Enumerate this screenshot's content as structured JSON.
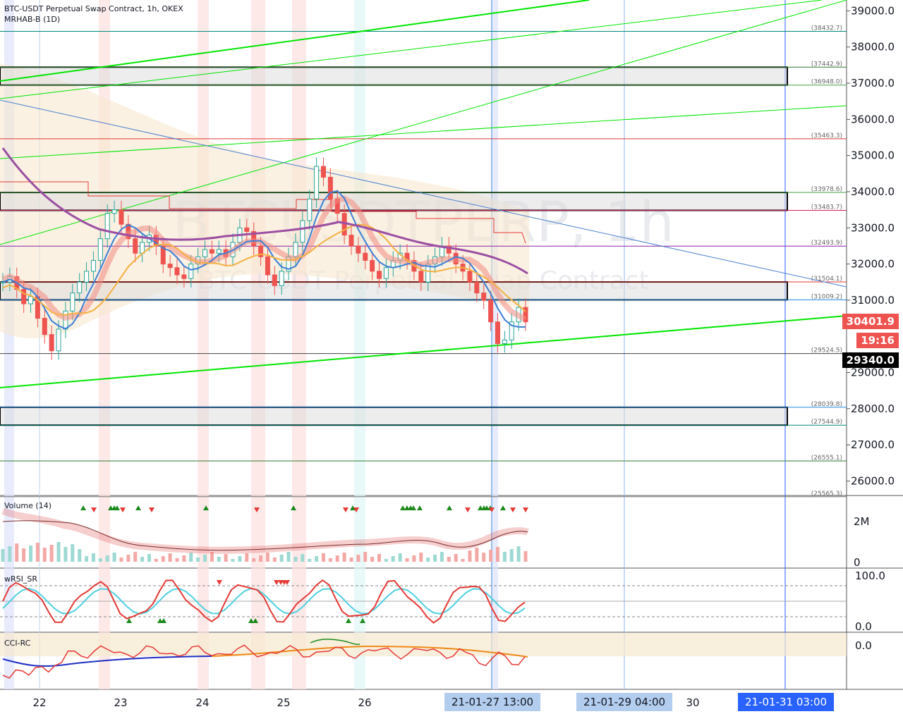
{
  "header": {
    "symbol_line": "BTC-USDT Perpetual Swap Contract, 1h, OKEX",
    "indicator_line": "MRHAB-B (1D)"
  },
  "watermark": {
    "symbol": "BTCUSDTPERP, 1h",
    "description": "BTC-USDT Perpetual Swap Contract"
  },
  "colors": {
    "up": "#26a69a",
    "down": "#ef5350",
    "trend_green": "#00e600",
    "level_red": "#e53935",
    "level_blue": "#1e88e5",
    "purple": "#9c4fa3",
    "price_badge": "#ef5350"
  },
  "price_badges": {
    "last_price": "30401.9",
    "countdown": "19:16",
    "crosshair_price": "29340.0"
  },
  "panes": {
    "volume": {
      "title": "Volume (14)",
      "ticks": [
        "2M",
        "0"
      ]
    },
    "wrsi": {
      "title": "wRSI_SR",
      "ticks": [
        "100.0",
        "0.0"
      ]
    },
    "cci": {
      "title": "CCI-RC",
      "ticks": [
        "0.0"
      ]
    }
  },
  "time_labels": {
    "days": [
      "22",
      "23",
      "24",
      "25",
      "26",
      "30"
    ],
    "highlight_a": "21-01-27   13:00",
    "highlight_b": "21-01-29   04:00",
    "highlight_c": "21-01-31   03:00"
  },
  "chart_data": {
    "type": "candlestick",
    "title": "BTC-USDT Perpetual Swap Contract, 1h, OKEX",
    "y_axis_ticks": [
      39000.0,
      38000.0,
      37000.0,
      36000.0,
      35000.0,
      34000.0,
      33000.0,
      32000.0,
      31000.0,
      29000.0,
      28000.0,
      27000.0,
      26000.0
    ],
    "ylim": [
      25600,
      39300
    ],
    "levels": [
      {
        "label": "(38432.7)",
        "value": 38432.7,
        "color": "#00897b"
      },
      {
        "label": "(37442.9)",
        "value": 37442.9,
        "color": "#2e7d32"
      },
      {
        "label": "(36948.0)",
        "value": 36948.0,
        "color": "#43a047"
      },
      {
        "label": "(35463.3)",
        "value": 35463.3,
        "color": "#e53935"
      },
      {
        "label": "(33978.6)",
        "value": 33978.6,
        "color": "#43a047"
      },
      {
        "label": "(33483.7)",
        "value": 33483.7,
        "color": "#d81b60"
      },
      {
        "label": "(32493.9)",
        "value": 32493.9,
        "color": "#8e24aa"
      },
      {
        "label": "(31504.1)",
        "value": 31504.1,
        "color": "#e53935"
      },
      {
        "label": "(31009.2)",
        "value": 31009.2,
        "color": "#1e88e5"
      },
      {
        "label": "(29524.5)",
        "value": 29524.5,
        "color": "#424242"
      },
      {
        "label": "(28039.8)",
        "value": 28039.8,
        "color": "#1e88e5"
      },
      {
        "label": "(27544.9)",
        "value": 27544.9,
        "color": "#00897b"
      },
      {
        "label": "(26555.1)",
        "value": 26555.1,
        "color": "#2e7d32"
      },
      {
        "label": "(25565.3)",
        "value": 25565.3,
        "color": "#757575"
      }
    ],
    "zones": [
      {
        "from": 36948.0,
        "to": 37442.9
      },
      {
        "from": 33483.7,
        "to": 33978.6
      },
      {
        "from": 31009.2,
        "to": 31504.1
      },
      {
        "from": 27544.9,
        "to": 28039.8
      }
    ],
    "ohlc_close_series": [
      31500,
      31650,
      31300,
      30900,
      31100,
      30500,
      30050,
      29600,
      30200,
      30700,
      31200,
      31500,
      31800,
      32100,
      32700,
      33400,
      33500,
      33100,
      32700,
      32300,
      32600,
      32800,
      32500,
      32000,
      31900,
      31700,
      31600,
      32000,
      32200,
      32400,
      32300,
      32400,
      32200,
      32600,
      33000,
      32900,
      32500,
      32200,
      31700,
      31400,
      31800,
      32200,
      32600,
      33200,
      33800,
      34700,
      34400,
      33800,
      33400,
      32800,
      32500,
      32300,
      32100,
      31800,
      31600,
      31900,
      32100,
      32300,
      32100,
      31800,
      31500,
      32000,
      32200,
      32500,
      32300,
      32000,
      31800,
      31500,
      31200,
      31000,
      30400,
      29800,
      29900,
      30400,
      30800,
      30400
    ]
  }
}
